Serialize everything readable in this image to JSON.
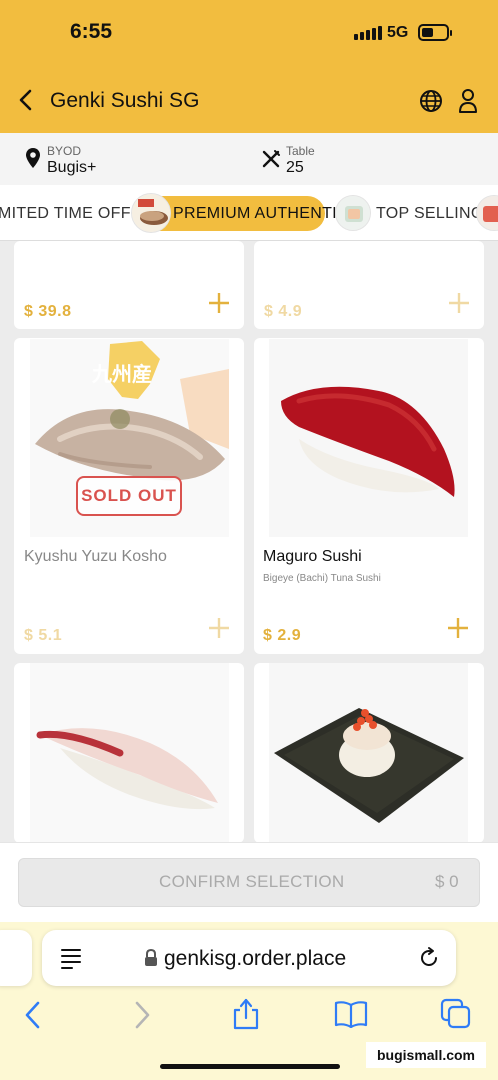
{
  "status_bar": {
    "time": "6:55",
    "network": "5G"
  },
  "header": {
    "title": "Genki Sushi SG"
  },
  "location": {
    "mode_label": "BYOD",
    "outlet": "Bugis+",
    "table_label": "Table",
    "table_number": "25"
  },
  "tabs": [
    {
      "label": "MITED TIME OFFER",
      "active": false
    },
    {
      "label": "PREMIUM AUTHENTIC",
      "active": true
    },
    {
      "label": "TOP SELLING",
      "active": false
    }
  ],
  "products": {
    "top_left": {
      "price": "$ 39.8"
    },
    "top_right": {
      "price": "$ 4.9"
    },
    "kyushu": {
      "name": "Kyushu Yuzu Kosho",
      "price": "$ 5.1",
      "badge": "SOLD OUT",
      "logo_text": "九州産"
    },
    "maguro": {
      "name": "Maguro Sushi",
      "description": "Bigeye (Bachi) Tuna Sushi",
      "price": "$ 2.9"
    }
  },
  "bottom_bar": {
    "confirm_label": "CONFIRM SELECTION",
    "total": "$ 0"
  },
  "browser": {
    "url": "genkisg.order.place"
  },
  "watermark": "bugismall.com",
  "colors": {
    "brand": "#f2bd3f",
    "price": "#e3b13d",
    "sold_out": "#d9534f",
    "ios_blue": "#2f7cf6"
  },
  "icons": [
    "back-arrow-icon",
    "globe-icon",
    "user-icon",
    "location-pin-icon",
    "cutlery-icon",
    "plus-icon",
    "reader-icon",
    "lock-icon",
    "reload-icon",
    "chevron-left-icon",
    "chevron-right-icon",
    "share-icon",
    "bookmarks-icon",
    "tabs-icon"
  ]
}
